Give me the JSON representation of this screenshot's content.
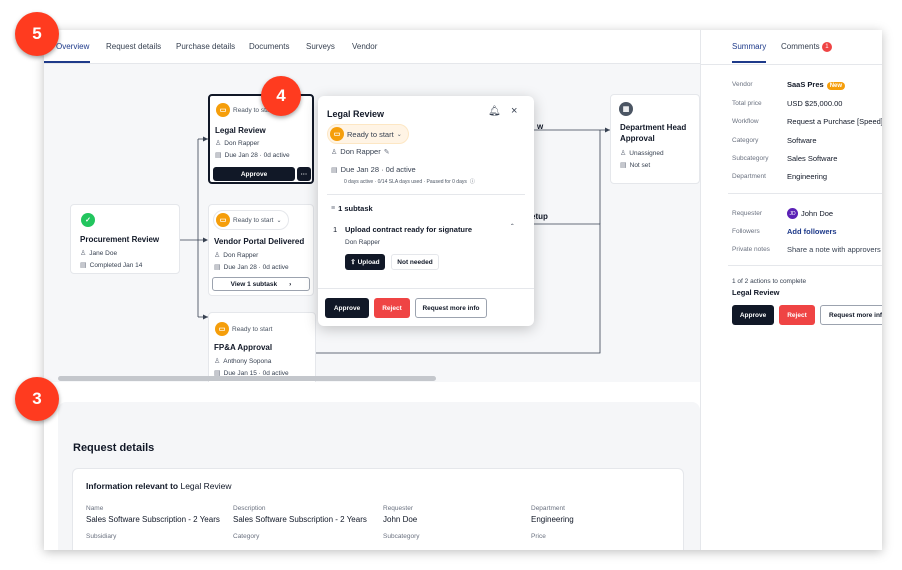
{
  "markers": [
    "5",
    "4",
    "3"
  ],
  "tabs": [
    "Overview",
    "Request details",
    "Purchase details",
    "Documents",
    "Surveys",
    "Vendor"
  ],
  "workflow": {
    "procurement": {
      "title": "Procurement Review",
      "assignee": "Jane Doe",
      "meta": "Completed Jan 14"
    },
    "legal": {
      "status": "Ready to start",
      "title": "Legal Review",
      "assignee": "Don Rapper",
      "due": "Due Jan 28 · 0d active",
      "approve": "Approve",
      "more": "···"
    },
    "vendor_portal": {
      "status": "Ready to start",
      "title": "Vendor Portal Delivered",
      "assignee": "Don Rapper",
      "due": "Due Jan 28 · 0d active",
      "subtask": "View 1 subtask"
    },
    "fpa": {
      "status": "Ready to start",
      "title": "FP&A Approval",
      "assignee": "Anthony Sopona",
      "due": "Due Jan 15 · 0d active"
    },
    "dept_head": {
      "title": "Department Head Approval",
      "assignee": "Unassigned",
      "due": "Not set"
    },
    "partial_1": "w",
    "partial_2": "etup"
  },
  "popover": {
    "title": "Legal Review",
    "status": "Ready to start",
    "assignee": "Don Rapper",
    "due": "Due Jan 28 · 0d active",
    "sla": "0 days active · 0/14 SLA days used · Paused for 0 days",
    "subtasks_header": "1 subtask",
    "subtask_num": "1",
    "subtask_title": "Upload contract ready for signature",
    "subtask_assignee": "Don Rapper",
    "upload": "Upload",
    "not_needed": "Not needed",
    "approve": "Approve",
    "reject": "Reject",
    "request_info": "Request more info"
  },
  "right_panel": {
    "tab_summary": "Summary",
    "tab_comments": "Comments",
    "comments_count": "1",
    "rows": [
      {
        "label": "Vendor",
        "value": "SaaS Pres",
        "badge": "New"
      },
      {
        "label": "Total price",
        "value": "USD $25,000.00"
      },
      {
        "label": "Workflow",
        "value": "Request a Purchase [Speed]"
      },
      {
        "label": "Category",
        "value": "Software"
      },
      {
        "label": "Subcategory",
        "value": "Sales Software"
      },
      {
        "label": "Department",
        "value": "Engineering"
      }
    ],
    "requester_label": "Requester",
    "requester_initials": "JD",
    "requester": "John Doe",
    "followers_label": "Followers",
    "followers": "Add followers",
    "notes_label": "Private notes",
    "notes": "Share a note with approvers",
    "actions_count": "1 of 2 actions to complete",
    "actions_step": "Legal Review",
    "approve": "Approve",
    "reject": "Reject",
    "request_info": "Request more info"
  },
  "request_details": {
    "heading": "Request details",
    "info_prefix": "Information relevant to",
    "info_suffix": "Legal Review",
    "fields": [
      {
        "label": "Name",
        "value": "Sales Software Subscription - 2 Years"
      },
      {
        "label": "Description",
        "value": "Sales Software Subscription - 2 Years"
      },
      {
        "label": "Requester",
        "value": "John Doe"
      },
      {
        "label": "Department",
        "value": "Engineering"
      },
      {
        "label": "Subsidiary",
        "value": ""
      },
      {
        "label": "Category",
        "value": ""
      },
      {
        "label": "Subcategory",
        "value": ""
      },
      {
        "label": "Price",
        "value": ""
      }
    ]
  },
  "colors": {
    "accent": "#1e3a8a",
    "danger": "#ef4444",
    "marker": "#ff3b1f",
    "warning": "#f59e0b",
    "success": "#22c55e"
  }
}
